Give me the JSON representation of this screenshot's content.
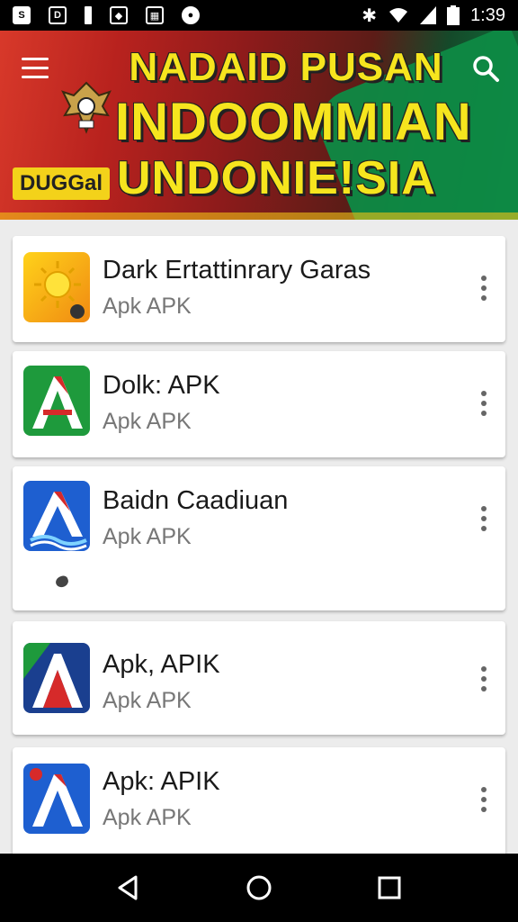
{
  "status_bar": {
    "icons": [
      "s-icon",
      "d-icon",
      "battery-saver-icon",
      "shield-icon",
      "image-icon",
      "settings-icon"
    ],
    "time": "1:39"
  },
  "banner": {
    "title_line1": "NADAID PUSAN",
    "title_line2": "INDOOMMIAN",
    "title_line3": "UNDONIE!SIA",
    "badge": "DUGGal",
    "menu_icon": "hamburger-menu-icon",
    "search_icon": "search-icon",
    "colors": {
      "red": "#b8221e",
      "green": "#0f7a3e",
      "yellow": "#f6e51e"
    }
  },
  "apps": [
    {
      "title": "Dark Ertattinrary Garas",
      "subtitle": "Apk APK",
      "icon": "sun-icon"
    },
    {
      "title": "Dolk: APK",
      "subtitle": "Apk APK",
      "icon": "letter-a-green-icon"
    },
    {
      "title": "Baidn Caadiuan",
      "subtitle": "Apk APK",
      "icon": "letter-a-blue-icon"
    },
    {
      "title": "Apk, APIK",
      "subtitle": "Apk APK",
      "icon": "letter-a-navy-icon"
    },
    {
      "title": "Apk: APIK",
      "subtitle": "Apk APK",
      "icon": "letter-a-blue-flag-icon"
    }
  ],
  "nav_bar": {
    "back": "back-icon",
    "home": "home-icon",
    "recents": "recents-icon"
  }
}
